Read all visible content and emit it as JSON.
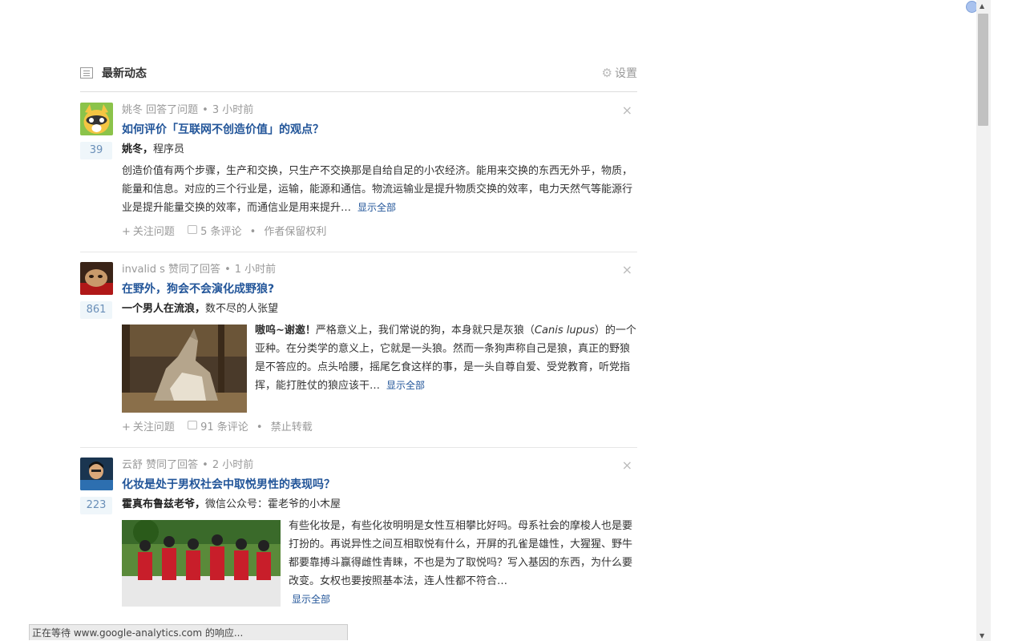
{
  "header": {
    "title": "最新动态",
    "settings_label": "设置"
  },
  "items": [
    {
      "meta_user": "姚冬",
      "meta_action": "回答了问题",
      "meta_time": "3 小时前",
      "votes": "39",
      "question": "如何评价「互联网不创造价值」的观点？",
      "author_name": "姚冬，",
      "author_bio": "程序员",
      "excerpt": "创造价值有两个步骤，生产和交换，只生产不交换那是自给自足的小农经济。能用来交换的东西无外乎，物质，能量和信息。对应的三个行业是，运输，能源和通信。物流运输业是提升物质交换的效率，电力天然气等能源行业是提升能量交换的效率，而通信业是用来提升…",
      "show_all": "显示全部",
      "follow": "关注问题",
      "comments": "5 条评论",
      "extra": "作者保留权利"
    },
    {
      "meta_user": "invalid s",
      "meta_action": "赞同了回答",
      "meta_time": "1 小时前",
      "votes": "861",
      "question": "在野外，狗会不会演化成野狼?",
      "author_name": "一个男人在流浪，",
      "author_bio": "数不尽的人张望",
      "excerpt_lead": "嗷呜~谢邀！",
      "excerpt_a": "严格意义上，我们常说的狗，本身就只是灰狼（",
      "excerpt_italic": "Canis lupus",
      "excerpt_b": "）的一个亚种。在分类学的意义上，它就是一头狼。然而一条狗声称自己是狼，真正的野狼是不答应的。点头哈腰，摇尾乞食这样的事，是一头自尊自爱、受党教育，听党指挥，能打胜仗的狼应该干…",
      "show_all": "显示全部",
      "follow": "关注问题",
      "comments": "91 条评论",
      "extra": "禁止转载"
    },
    {
      "meta_user": "云舒",
      "meta_action": "赞同了回答",
      "meta_time": "2 小时前",
      "votes": "223",
      "question": "化妆是处于男权社会中取悦男性的表现吗？",
      "author_name": "霍真布鲁兹老爷，",
      "author_bio": "微信公众号：霍老爷的小木屋",
      "excerpt": "有些化妆是，有些化妆明明是女性互相攀比好吗。母系社会的摩梭人也是要打扮的。再说异性之间互相取悦有什么，开屏的孔雀是雄性，大猩猩、野牛都要靠搏斗赢得雌性青睐，不也是为了取悦吗？写入基因的东西，为什么要改变。女权也要按照基本法，连人性都不符合…",
      "show_all": "显示全部"
    }
  ],
  "statusbar": "正在等待 www.google-analytics.com 的响应..."
}
